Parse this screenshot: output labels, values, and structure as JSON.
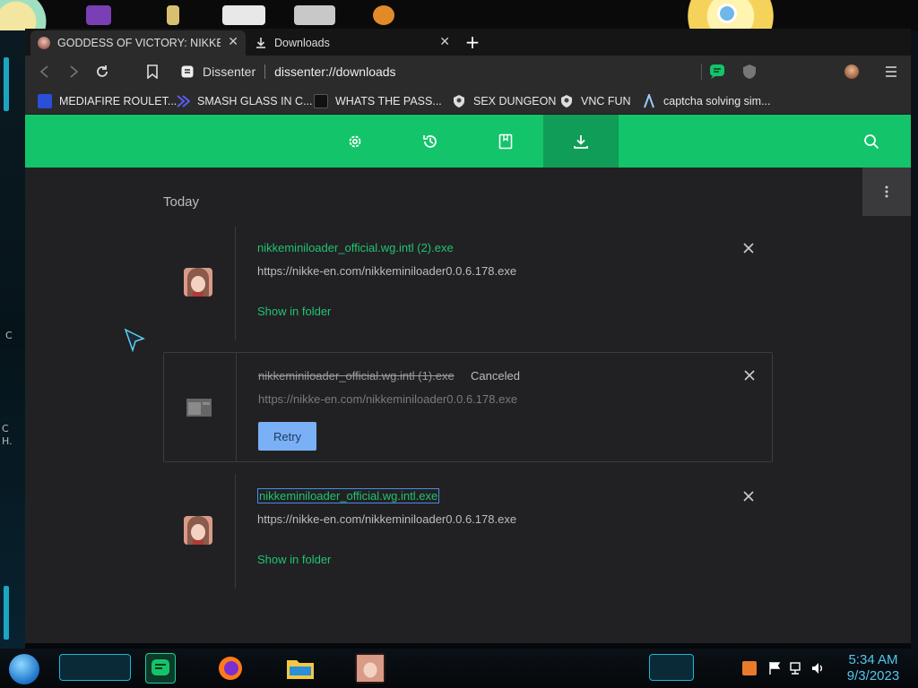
{
  "colors": {
    "accent_green": "#13c46a",
    "accent_green_dark": "#0f9d57",
    "link_green": "#21c36f",
    "retry_blue": "#7ab0f5",
    "page_bg": "#212124",
    "clock_blue": "#54c6ef"
  },
  "desktop": {
    "side_text_c": "C",
    "side_text_c2": "C",
    "side_text_h": "H."
  },
  "tabs": [
    {
      "title": "GODDESS OF VICTORY: NIKKE | Im",
      "icon": "nikke-avatar-icon",
      "active": true
    },
    {
      "title": "Downloads",
      "icon": "download-icon",
      "active": false
    }
  ],
  "toolbar": {
    "site_name": "Dissenter",
    "url": "dissenter://downloads"
  },
  "bookmarks": [
    {
      "label": "MEDIAFIRE ROULET...",
      "icon": "mediafire-icon"
    },
    {
      "label": "SMASH GLASS IN C...",
      "icon": "smash-icon"
    },
    {
      "label": "WHATS THE PASS...",
      "icon": "black-square-icon"
    },
    {
      "label": "SEX DUNGEON",
      "icon": "shield-badge-icon"
    },
    {
      "label": "VNC FUN",
      "icon": "shield-badge-icon"
    },
    {
      "label": "captcha solving sim...",
      "icon": "alpha-a-icon"
    }
  ],
  "downloads_page": {
    "section": "Today",
    "items": [
      {
        "filename": "nikkeminiloader_official.wg.intl (2).exe",
        "url": "https://nikke-en.com/nikkeminiloader0.0.6.178.exe",
        "status": "",
        "action": "Show in folder",
        "state": "complete"
      },
      {
        "filename": "nikkeminiloader_official.wg.intl (1).exe",
        "url": "https://nikke-en.com/nikkeminiloader0.0.6.178.exe",
        "status": "Canceled",
        "action": "Retry",
        "state": "canceled"
      },
      {
        "filename": "nikkeminiloader_official.wg.intl.exe",
        "url": "https://nikke-en.com/nikkeminiloader0.0.6.178.exe",
        "status": "",
        "action": "Show in folder",
        "state": "complete"
      }
    ]
  },
  "taskbar": {
    "time": "5:34 AM",
    "date": "9/3/2023"
  }
}
